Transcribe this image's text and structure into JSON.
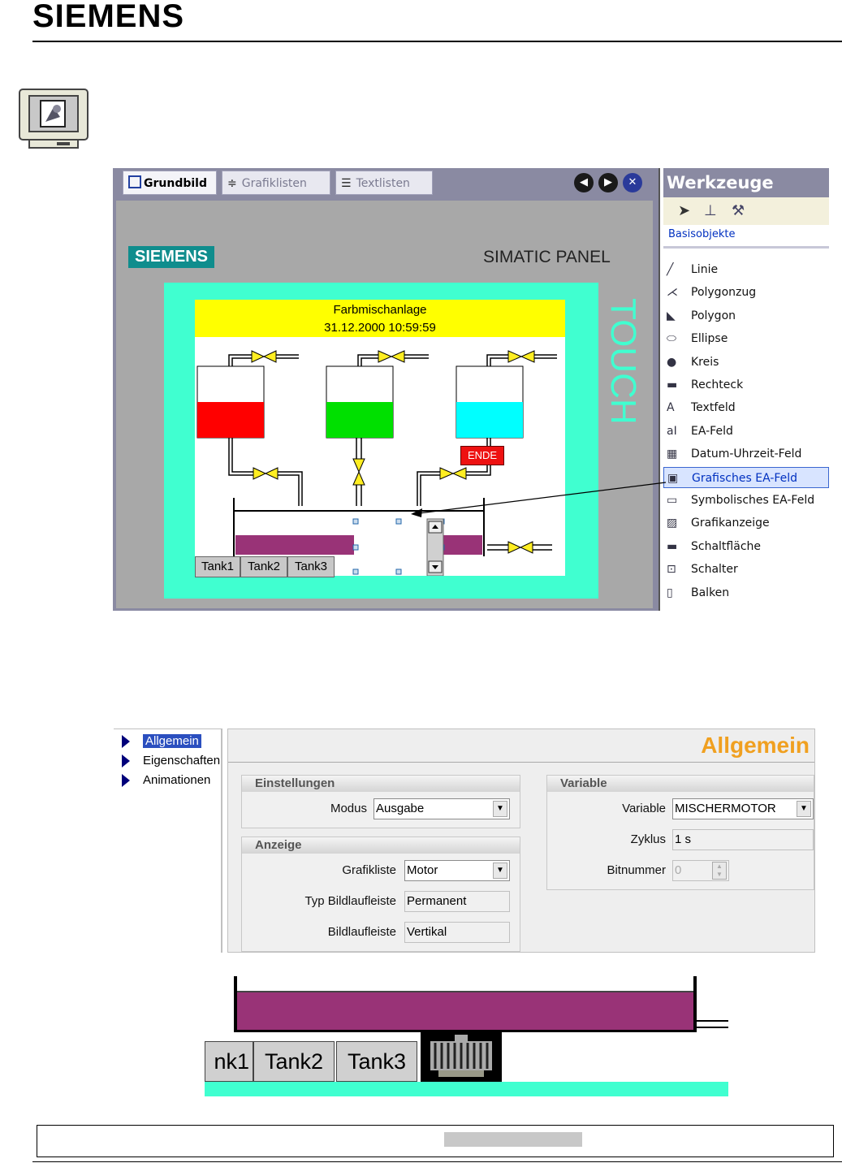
{
  "brand": "SIEMENS",
  "editor": {
    "tabs": [
      {
        "label": "Grundbild"
      },
      {
        "label": "Grafiklisten"
      },
      {
        "label": "Textlisten"
      }
    ],
    "panel_brand": "SIEMENS",
    "panel_title": "SIMATIC PANEL",
    "touch_label": "TOUCH",
    "screen": {
      "title": "Farbmischanlage",
      "datetime": "31.12.2000 10:59:59",
      "ende_label": "ENDE",
      "tank_buttons": [
        "Tank1",
        "Tank2",
        "Tank3"
      ],
      "tank_colors": [
        "#ff0000",
        "#00e000",
        "#00ffff"
      ],
      "mixer_color": "#993377"
    }
  },
  "tools": {
    "title": "Werkzeuge",
    "section": "Basisobjekte",
    "items": [
      {
        "label": "Linie",
        "icon": "line-icon"
      },
      {
        "label": "Polygonzug",
        "icon": "polyline-icon"
      },
      {
        "label": "Polygon",
        "icon": "polygon-icon"
      },
      {
        "label": "Ellipse",
        "icon": "ellipse-icon"
      },
      {
        "label": "Kreis",
        "icon": "circle-icon"
      },
      {
        "label": "Rechteck",
        "icon": "rectangle-icon"
      },
      {
        "label": "Textfeld",
        "icon": "textfield-icon"
      },
      {
        "label": "EA-Feld",
        "icon": "io-field-icon"
      },
      {
        "label": "Datum-Uhrzeit-Feld",
        "icon": "datetime-icon"
      },
      {
        "label": "Grafisches EA-Feld",
        "icon": "graphic-io-icon",
        "selected": true
      },
      {
        "label": "Symbolisches EA-Feld",
        "icon": "symbolic-io-icon"
      },
      {
        "label": "Grafikanzeige",
        "icon": "graphic-view-icon"
      },
      {
        "label": "Schaltfläche",
        "icon": "button-icon"
      },
      {
        "label": "Schalter",
        "icon": "switch-icon"
      },
      {
        "label": "Balken",
        "icon": "bar-icon"
      }
    ]
  },
  "props": {
    "tree": [
      "Allgemein",
      "Eigenschaften",
      "Animationen"
    ],
    "title": "Allgemein",
    "einstellungen": {
      "header": "Einstellungen",
      "modus_label": "Modus",
      "modus_value": "Ausgabe"
    },
    "anzeige": {
      "header": "Anzeige",
      "grafikliste_label": "Grafikliste",
      "grafikliste_value": "Motor",
      "typ_label": "Typ Bildlaufleiste",
      "typ_value": "Permanent",
      "bild_label": "Bildlaufleiste",
      "bild_value": "Vertikal"
    },
    "variable": {
      "header": "Variable",
      "variable_label": "Variable",
      "variable_value": "MISCHERMOTOR",
      "zyklus_label": "Zyklus",
      "zyklus_value": "1 s",
      "bitnummer_label": "Bitnummer",
      "bitnummer_value": "0"
    }
  },
  "preview": {
    "tank_buttons": [
      "nk1",
      "Tank2",
      "Tank3"
    ]
  }
}
